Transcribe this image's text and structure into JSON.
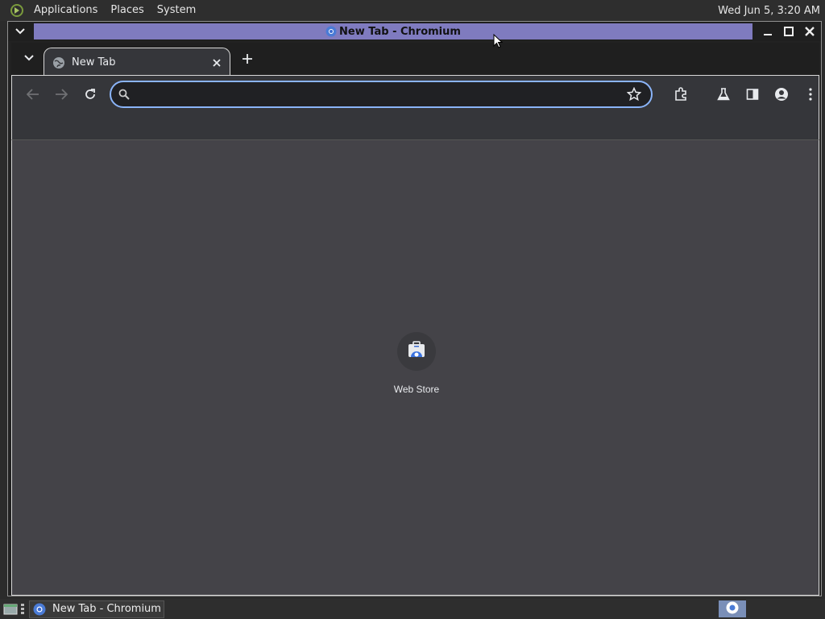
{
  "top_panel": {
    "menus": [
      "Applications",
      "Places",
      "System"
    ],
    "clock": "Wed Jun  5,  3:20 AM"
  },
  "window": {
    "title": "New Tab - Chromium"
  },
  "browser": {
    "tabs": [
      {
        "label": "New Tab",
        "active": true
      }
    ],
    "omnibox": {
      "value": "",
      "placeholder": ""
    },
    "shortcuts": [
      {
        "label": "Web Store",
        "icon": "web-store-icon"
      }
    ]
  },
  "taskbar": {
    "items": [
      {
        "label": "New Tab - Chromium",
        "icon": "chromium-icon"
      }
    ]
  },
  "colors": {
    "title_strip": "#7f7bbf",
    "omnibox_focus": "#8ab4f8",
    "content_bg": "#444348",
    "toolbar_bg": "#35363a"
  }
}
